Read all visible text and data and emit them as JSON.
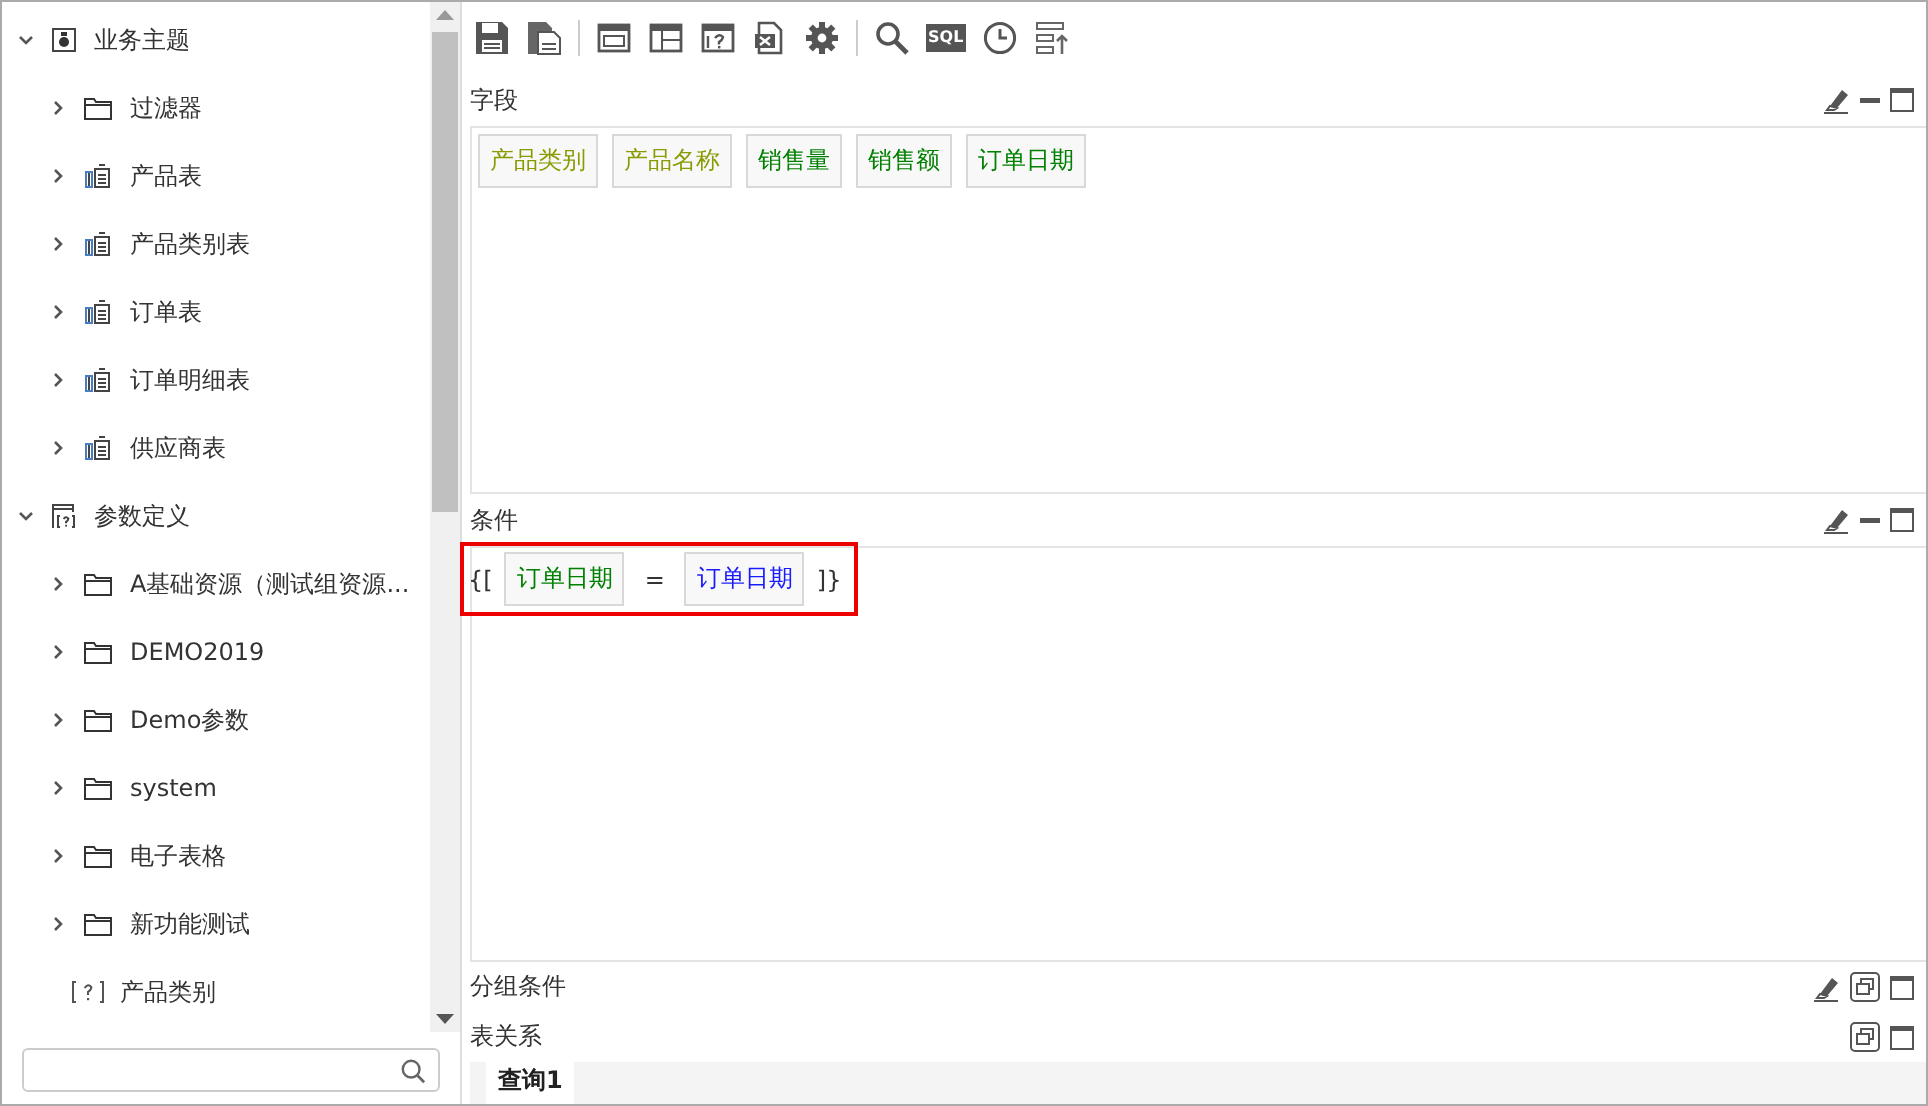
{
  "sidebar": {
    "tree": [
      {
        "label": "业务主题",
        "kind": "theme",
        "expanded": true,
        "children": [
          {
            "label": "过滤器",
            "kind": "folder",
            "expanded": false
          },
          {
            "label": "产品表",
            "kind": "table",
            "expanded": false
          },
          {
            "label": "产品类别表",
            "kind": "table",
            "expanded": false
          },
          {
            "label": "订单表",
            "kind": "table",
            "expanded": false
          },
          {
            "label": "订单明细表",
            "kind": "table",
            "expanded": false
          },
          {
            "label": "供应商表",
            "kind": "table",
            "expanded": false
          }
        ]
      },
      {
        "label": "参数定义",
        "kind": "params",
        "expanded": true,
        "children": [
          {
            "label": "A基础资源（测试组资源...",
            "kind": "folder",
            "expanded": false
          },
          {
            "label": "DEMO2019",
            "kind": "folder",
            "expanded": false
          },
          {
            "label": "Demo参数",
            "kind": "folder",
            "expanded": false
          },
          {
            "label": "system",
            "kind": "folder",
            "expanded": false
          },
          {
            "label": "电子表格",
            "kind": "folder",
            "expanded": false
          },
          {
            "label": "新功能测试",
            "kind": "folder",
            "expanded": false
          },
          {
            "label": "产品类别",
            "kind": "param"
          }
        ]
      }
    ]
  },
  "toolbar": [
    {
      "kind": "save"
    },
    {
      "kind": "save-as"
    },
    {
      "kind": "sep"
    },
    {
      "kind": "layout"
    },
    {
      "kind": "layout2"
    },
    {
      "kind": "help-layout"
    },
    {
      "kind": "export"
    },
    {
      "kind": "gear"
    },
    {
      "kind": "sep"
    },
    {
      "kind": "search"
    },
    {
      "kind": "sql",
      "label": "SQL"
    },
    {
      "kind": "clock"
    },
    {
      "kind": "sort"
    }
  ],
  "fields": {
    "title": "字段",
    "tools": [
      {
        "kind": "eraser"
      },
      {
        "kind": "minimize"
      },
      {
        "kind": "maximize"
      }
    ],
    "chips": [
      {
        "label": "产品类别",
        "color": "#8a9a00"
      },
      {
        "label": "产品名称",
        "color": "#8a9a00"
      },
      {
        "label": "销售量",
        "color": "#008000"
      },
      {
        "label": "销售额",
        "color": "#008000"
      },
      {
        "label": "订单日期",
        "color": "#008000"
      }
    ]
  },
  "conditions": {
    "title": "条件",
    "tools": [
      {
        "kind": "eraser"
      },
      {
        "kind": "minimize"
      },
      {
        "kind": "maximize"
      }
    ],
    "open": "{[",
    "left": {
      "label": "订单日期",
      "color": "#008000"
    },
    "operator": "=",
    "right": {
      "label": "订单日期",
      "color": "#1a1aff"
    },
    "close": "]}",
    "highlighted": true
  },
  "group_conditions": {
    "title": "分组条件",
    "tools": [
      {
        "kind": "eraser"
      },
      {
        "kind": "restore"
      },
      {
        "kind": "maximize"
      }
    ]
  },
  "relations": {
    "title": "表关系",
    "tools": [
      {
        "kind": "restore"
      },
      {
        "kind": "maximize"
      }
    ],
    "tabs": [
      {
        "label": "查询1",
        "selected": true
      }
    ]
  }
}
